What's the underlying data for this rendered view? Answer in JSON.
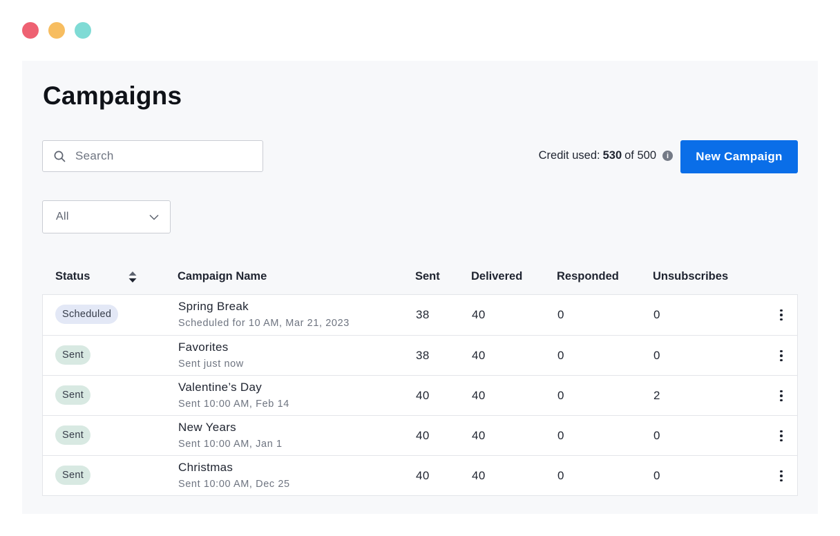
{
  "window": {
    "controls": [
      {
        "name": "close",
        "color": "#ee6172"
      },
      {
        "name": "minimize",
        "color": "#f7bd60"
      },
      {
        "name": "zoom",
        "color": "#7fdbd5"
      }
    ]
  },
  "page": {
    "title": "Campaigns"
  },
  "search": {
    "placeholder": "Search",
    "icon": "search-icon"
  },
  "credit": {
    "label": "Credit used:",
    "used": "530",
    "of": "of 500",
    "info_icon": "info-icon"
  },
  "actions": {
    "new_campaign": "New Campaign",
    "accent": "#0a6ee8"
  },
  "filter": {
    "selected": "All",
    "icon": "chevron-down-icon"
  },
  "table": {
    "columns": {
      "status": "Status",
      "name": "Campaign Name",
      "sent": "Sent",
      "delivered": "Delivered",
      "responded": "Responded",
      "unsubscribes": "Unsubscribes"
    },
    "rows": [
      {
        "status": "Scheduled",
        "name": "Spring Break",
        "sub": "Scheduled for 10 AM, Mar 21, 2023",
        "sent": "38",
        "delivered": "40",
        "responded": "0",
        "unsubscribes": "0"
      },
      {
        "status": "Sent",
        "name": "Favorites",
        "sub": "Sent just now",
        "sent": "38",
        "delivered": "40",
        "responded": "0",
        "unsubscribes": "0"
      },
      {
        "status": "Sent",
        "name": "Valentine’s Day",
        "sub": "Sent 10:00 AM, Feb 14",
        "sent": "40",
        "delivered": "40",
        "responded": "0",
        "unsubscribes": "2"
      },
      {
        "status": "Sent",
        "name": "New Years",
        "sub": "Sent 10:00 AM, Jan 1",
        "sent": "40",
        "delivered": "40",
        "responded": "0",
        "unsubscribes": "0"
      },
      {
        "status": "Sent",
        "name": "Christmas",
        "sub": "Sent 10:00 AM, Dec 25",
        "sent": "40",
        "delivered": "40",
        "responded": "0",
        "unsubscribes": "0"
      }
    ]
  }
}
